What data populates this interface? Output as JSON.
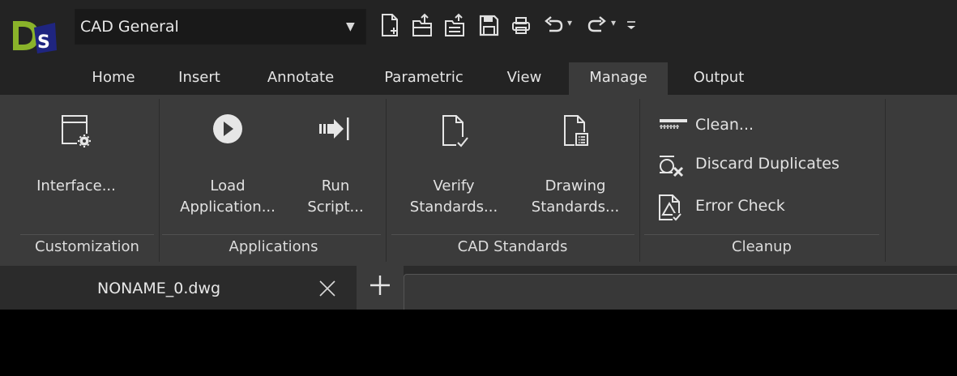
{
  "titlebar": {
    "workspace": "CAD General"
  },
  "quick_access": {
    "icons": [
      "new-file-icon",
      "open-file-icon",
      "open-sheet-icon",
      "save-icon",
      "print-icon",
      "undo-icon",
      "redo-icon",
      "customize-icon"
    ]
  },
  "tabs": [
    {
      "label": "Home"
    },
    {
      "label": "Insert"
    },
    {
      "label": "Annotate"
    },
    {
      "label": "Parametric"
    },
    {
      "label": "View"
    },
    {
      "label": "Manage"
    },
    {
      "label": "Output"
    }
  ],
  "active_tab": "Manage",
  "ribbon": {
    "groups": {
      "customization": {
        "label": "Customization",
        "buttons": {
          "interface": "Interface..."
        }
      },
      "applications": {
        "label": "Applications",
        "buttons": {
          "load_line1": "Load",
          "load_line2": "Application...",
          "run_line1": "Run",
          "run_line2": "Script..."
        }
      },
      "cad_standards": {
        "label": "CAD Standards",
        "buttons": {
          "verify_line1": "Verify",
          "verify_line2": "Standards...",
          "drawing_line1": "Drawing",
          "drawing_line2": "Standards..."
        }
      },
      "cleanup": {
        "label": "Cleanup",
        "buttons": {
          "clean": "Clean...",
          "discard": "Discard Duplicates",
          "error_check": "Error Check"
        }
      }
    }
  },
  "document": {
    "tab_name": "NONAME_0.dwg"
  },
  "colors": {
    "titlebar_bg": "#232323",
    "ribbon_bg": "#3b3b3b",
    "canvas_bg": "#000000",
    "logo_green": "#8ab32a",
    "logo_blue": "#2a2f8c"
  }
}
